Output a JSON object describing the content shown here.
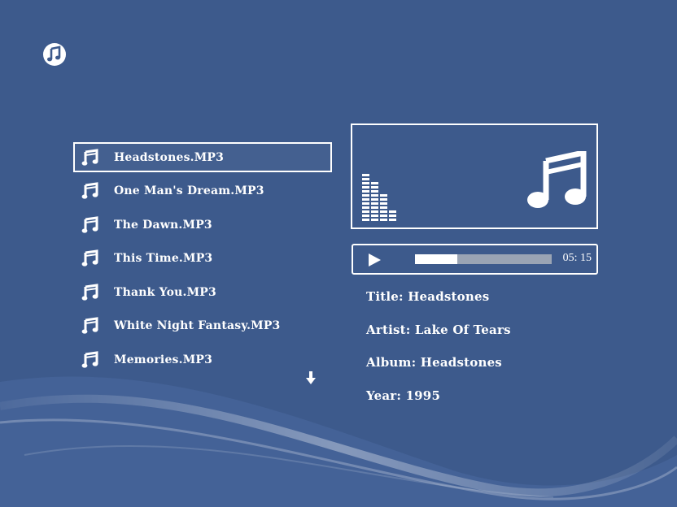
{
  "theme": {
    "background": "#3d5a8c",
    "foreground": "#ffffff",
    "progress_track": "#9aa4b4"
  },
  "header": {
    "icon": "music-note-circle-icon"
  },
  "playlist": {
    "items": [
      {
        "label": "Headstones.MP3",
        "selected": true
      },
      {
        "label": "One Man's Dream.MP3",
        "selected": false
      },
      {
        "label": "The Dawn.MP3",
        "selected": false
      },
      {
        "label": "This Time.MP3",
        "selected": false
      },
      {
        "label": "Thank You.MP3",
        "selected": false
      },
      {
        "label": "White Night Fantasy.MP3",
        "selected": false
      },
      {
        "label": "Memories.MP3",
        "selected": false
      }
    ],
    "more_indicator": "down-arrow-icon"
  },
  "player": {
    "state_icon": "play-icon",
    "progress": 0.31,
    "duration": "05: 15"
  },
  "info": {
    "title": "Title: Headstones",
    "artist": "Artist: Lake Of Tears",
    "album": "Album: Headstones",
    "year": "Year: 1995"
  }
}
